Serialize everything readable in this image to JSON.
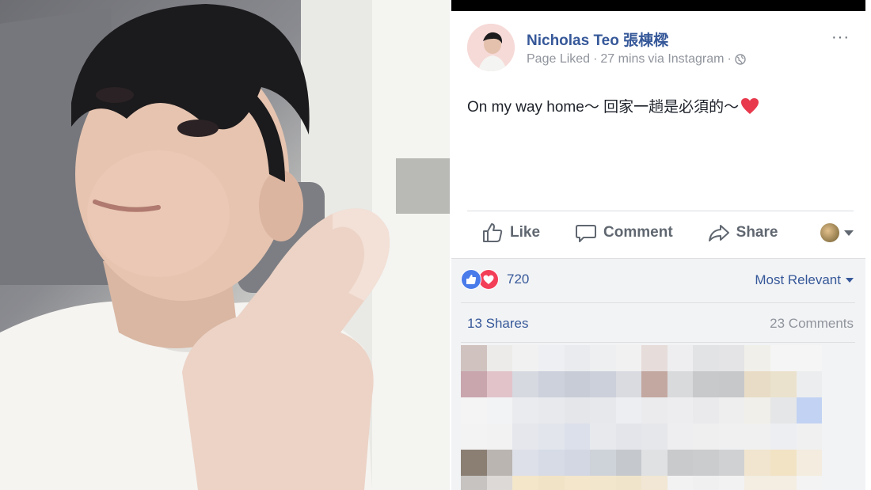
{
  "post": {
    "author": "Nicholas Teo 張棟樑",
    "meta_activity": "Page Liked",
    "meta_time": "27 mins",
    "meta_via": "via Instagram",
    "text": "On my way home～ 回家一趟是必須的～",
    "more_label": "···"
  },
  "actions": {
    "like": "Like",
    "comment": "Comment",
    "share": "Share"
  },
  "reactions": {
    "count": "720",
    "sort": "Most Relevant"
  },
  "stats": {
    "shares": "13 Shares",
    "comments": "23 Comments"
  },
  "icons": [
    "like-thumb-icon",
    "comment-bubble-icon",
    "share-arrow-icon",
    "globe-icon",
    "heart-emoji-icon",
    "more-options-icon"
  ],
  "colors": {
    "link": "#365899",
    "muted": "#90949c",
    "like_blue": "#4a7bea",
    "love_red": "#f33e58"
  }
}
